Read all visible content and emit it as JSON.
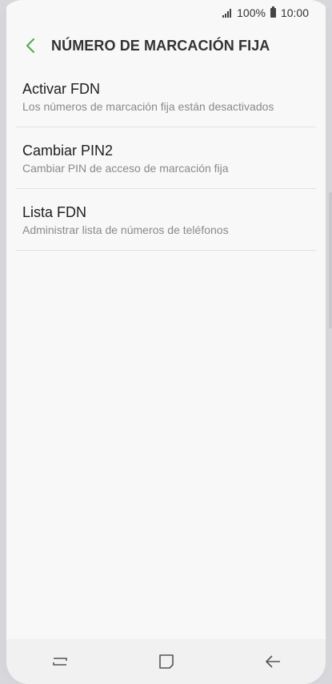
{
  "status_bar": {
    "battery_percent": "100%",
    "time": "10:00",
    "icons": [
      "signal-icon",
      "battery-icon"
    ]
  },
  "header": {
    "title": "NÚMERO DE MARCACIÓN FIJA",
    "back_icon": "chevron-left-icon",
    "accent_color": "#5aa85a"
  },
  "settings": {
    "items": [
      {
        "title": "Activar FDN",
        "subtitle": "Los números de marcación fija están desactivados"
      },
      {
        "title": "Cambiar PIN2",
        "subtitle": "Cambiar PIN de acceso de marcación fija"
      },
      {
        "title": "Lista FDN",
        "subtitle": "Administrar lista de números de teléfonos"
      }
    ]
  },
  "nav_bar": {
    "buttons": [
      "recent-apps-icon",
      "home-icon",
      "back-icon"
    ]
  }
}
